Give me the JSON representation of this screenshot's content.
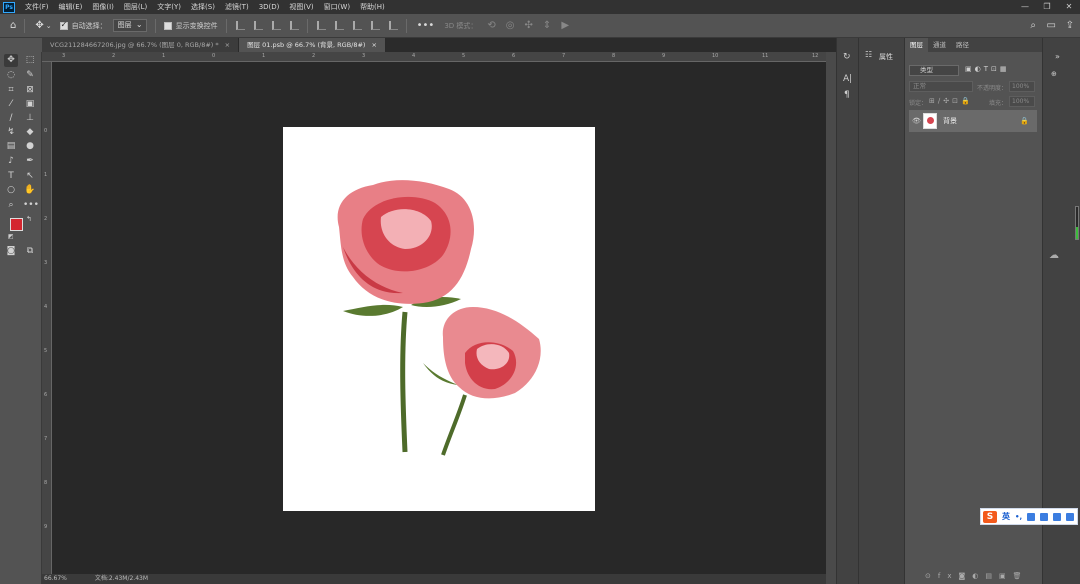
{
  "app": {
    "logo": "Ps"
  },
  "menu": [
    "文件(F)",
    "编辑(E)",
    "图像(I)",
    "图层(L)",
    "文字(Y)",
    "选择(S)",
    "滤镜(T)",
    "3D(D)",
    "视图(V)",
    "窗口(W)",
    "帮助(H)"
  ],
  "window_controls": [
    "—",
    "❐",
    "✕"
  ],
  "options": {
    "auto_select_label": "自动选择：",
    "auto_select_value": "图层",
    "show_transform_label": "显示变换控件",
    "mode_3d_label": "3D 模式："
  },
  "tabs": [
    {
      "title": "VCG211284667206.jpg @ 66.7% (图层 0, RGB/8#) *",
      "close": "×"
    },
    {
      "title": "图层 01.psb @ 66.7% (背景, RGB/8#)",
      "close": "×"
    }
  ],
  "ruler": {
    "top": [
      "3",
      "2",
      "1",
      "0",
      "1",
      "2",
      "3",
      "4",
      "5",
      "6",
      "7",
      "8",
      "9",
      "10",
      "11",
      "12"
    ],
    "left": [
      "0",
      "1",
      "2",
      "3",
      "4",
      "5",
      "6",
      "7",
      "8",
      "9"
    ]
  },
  "status": {
    "zoom": "66.67%",
    "doc": "文档:2.43M/2.43M"
  },
  "properties": {
    "tab": "属性"
  },
  "layers": {
    "tabs": [
      "图层",
      "通道",
      "路径"
    ],
    "filter_label": "类型",
    "blend_mode": "正常",
    "opacity_label": "不透明度：",
    "opacity_value": "100%",
    "lock_label": "锁定：",
    "fill_label": "填充：",
    "fill_value": "100%",
    "layer_name": "背景"
  },
  "ime": {
    "lang": "英"
  },
  "colors": {
    "foreground": "#d4262f",
    "background": "#ffffff"
  }
}
